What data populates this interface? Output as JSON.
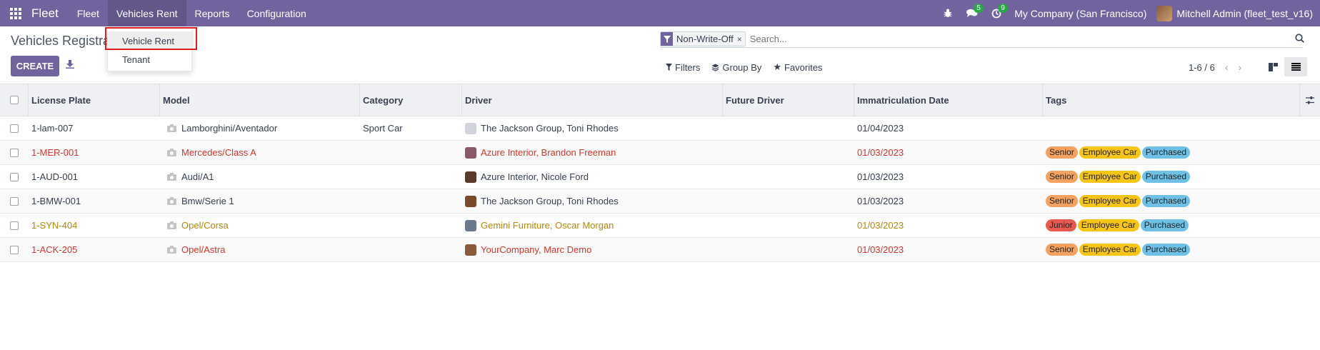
{
  "navbar": {
    "brand": "Fleet",
    "menu": [
      {
        "label": "Fleet"
      },
      {
        "label": "Vehicles Rent"
      },
      {
        "label": "Reports"
      },
      {
        "label": "Configuration"
      }
    ],
    "messages_count": "5",
    "activities_count": "9",
    "company": "My Company (San Francisco)",
    "user": "Mitchell Admin (fleet_test_v16)"
  },
  "page": {
    "title": "Vehicles Registra",
    "create_label": "CREATE"
  },
  "dropdown": {
    "items": [
      {
        "label": "Vehicle Rent"
      },
      {
        "label": "Tenant"
      }
    ]
  },
  "search": {
    "facet": "Non-Write-Off",
    "facet_remove": "×",
    "placeholder": "Search..."
  },
  "filters": {
    "filters_label": "Filters",
    "groupby_label": "Group By",
    "favorites_label": "Favorites"
  },
  "pager": {
    "value": "1-6 / 6",
    "prev": "‹",
    "next": "›"
  },
  "table": {
    "columns": [
      "License Plate",
      "Model",
      "Category",
      "Driver",
      "Future Driver",
      "Immatriculation Date",
      "Tags"
    ],
    "rows": [
      {
        "plate": "1-lam-007",
        "model": "Lamborghini/Aventador",
        "category": "Sport Car",
        "driver": "The Jackson Group, Toni Rhodes",
        "future_driver": "",
        "date": "01/04/2023",
        "tags": [],
        "status": "normal"
      },
      {
        "plate": "1-MER-001",
        "model": "Mercedes/Class A",
        "category": "",
        "driver": "Azure Interior, Brandon Freeman",
        "future_driver": "",
        "date": "01/03/2023",
        "tags": [
          "Senior",
          "Employee Car",
          "Purchased"
        ],
        "status": "red"
      },
      {
        "plate": "1-AUD-001",
        "model": "Audi/A1",
        "category": "",
        "driver": "Azure Interior, Nicole Ford",
        "future_driver": "",
        "date": "01/03/2023",
        "tags": [
          "Senior",
          "Employee Car",
          "Purchased"
        ],
        "status": "normal"
      },
      {
        "plate": "1-BMW-001",
        "model": "Bmw/Serie 1",
        "category": "",
        "driver": "The Jackson Group, Toni Rhodes",
        "future_driver": "",
        "date": "01/03/2023",
        "tags": [
          "Senior",
          "Employee Car",
          "Purchased"
        ],
        "status": "normal"
      },
      {
        "plate": "1-SYN-404",
        "model": "Opel/Corsa",
        "category": "",
        "driver": "Gemini Furniture, Oscar Morgan",
        "future_driver": "",
        "date": "01/03/2023",
        "tags": [
          "Junior",
          "Employee Car",
          "Purchased"
        ],
        "status": "gold"
      },
      {
        "plate": "1-ACK-205",
        "model": "Opel/Astra",
        "category": "",
        "driver": "YourCompany, Marc Demo",
        "future_driver": "",
        "date": "01/03/2023",
        "tags": [
          "Senior",
          "Employee Car",
          "Purchased"
        ],
        "status": "red"
      }
    ]
  },
  "colors": {
    "brand": "#71639e",
    "red_text": "#d9352b",
    "gold_text": "#b8860b",
    "tag_senior": "#f4a261",
    "tag_junior": "#e85a4f",
    "tag_employee_car": "#f5c518",
    "tag_purchased": "#6ec1e4"
  }
}
